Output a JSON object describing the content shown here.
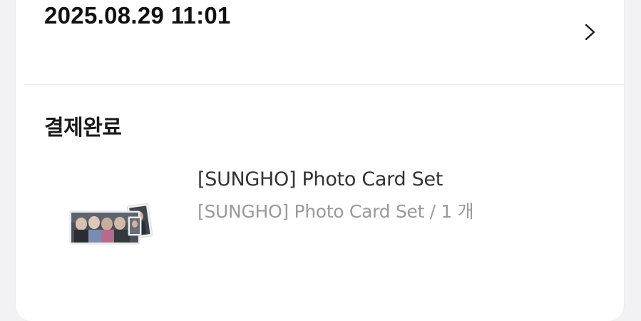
{
  "order": {
    "datetime": "2025.08.29 11:01",
    "status": "결제완료"
  },
  "item": {
    "name": "[SUNGHO] Photo Card Set",
    "option": "[SUNGHO] Photo Card Set / 1 개",
    "thumbnail_icon": "photo-card-thumbnail"
  },
  "icons": {
    "detail": "chevron-right-icon"
  },
  "colors": {
    "background": "#f2f2f4",
    "card": "#ffffff",
    "primary_text": "#111111",
    "secondary_text": "#9a9a9e"
  }
}
